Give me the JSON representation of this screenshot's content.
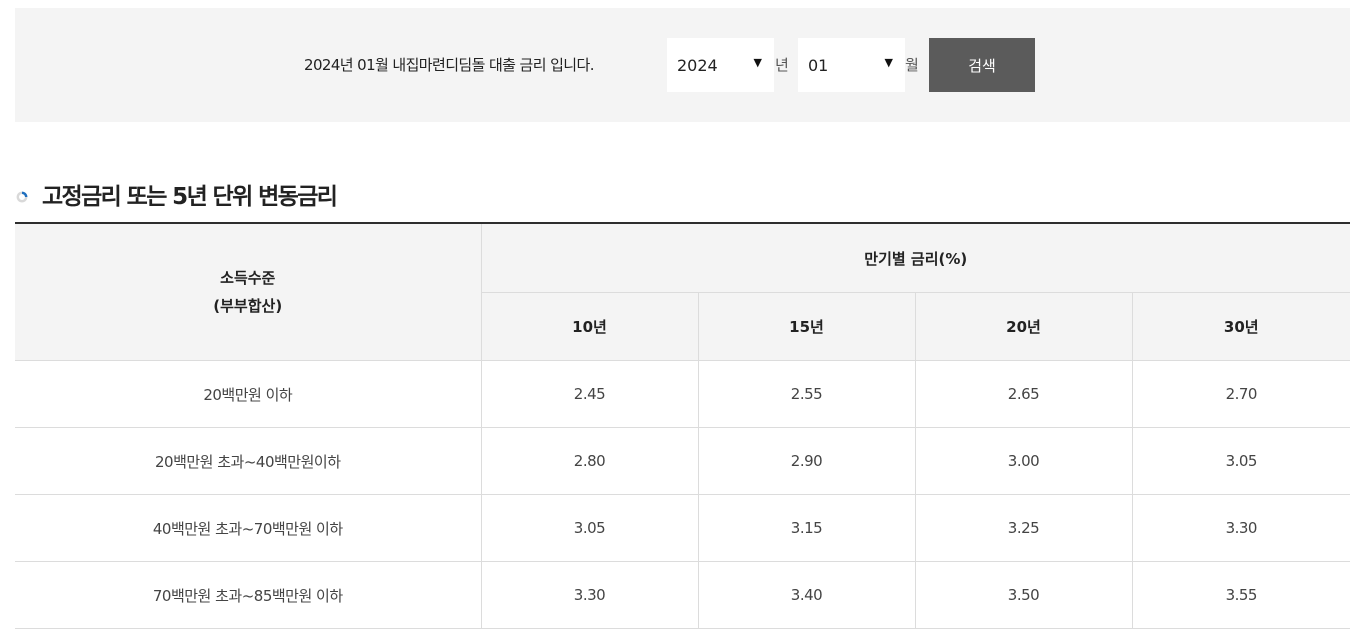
{
  "search": {
    "message": "2024년 01월 내집마련디딤돌 대출 금리 입니다.",
    "year_value": "2024",
    "year_unit": "년",
    "month_value": "01",
    "month_unit": "월",
    "button_label": "검색",
    "arrow_icon": "▼"
  },
  "section": {
    "title": "고정금리 또는 5년 단위 변동금리",
    "bullet_icon": "circle-bullet-icon",
    "accent_color": "#1f6fbf"
  },
  "table": {
    "income_header_line1": "소득수준",
    "income_header_line2": "(부부합산)",
    "term_header": "만기별 금리(%)",
    "terms": [
      "10년",
      "15년",
      "20년",
      "30년"
    ],
    "rows": [
      {
        "income": "20백만원 이하",
        "rates": [
          "2.45",
          "2.55",
          "2.65",
          "2.70"
        ]
      },
      {
        "income": "20백만원 초과~40백만원이하",
        "rates": [
          "2.80",
          "2.90",
          "3.00",
          "3.05"
        ]
      },
      {
        "income": "40백만원 초과~70백만원 이하",
        "rates": [
          "3.05",
          "3.15",
          "3.25",
          "3.30"
        ]
      },
      {
        "income": "70백만원 초과~85백만원 이하",
        "rates": [
          "3.30",
          "3.40",
          "3.50",
          "3.55"
        ]
      }
    ]
  }
}
